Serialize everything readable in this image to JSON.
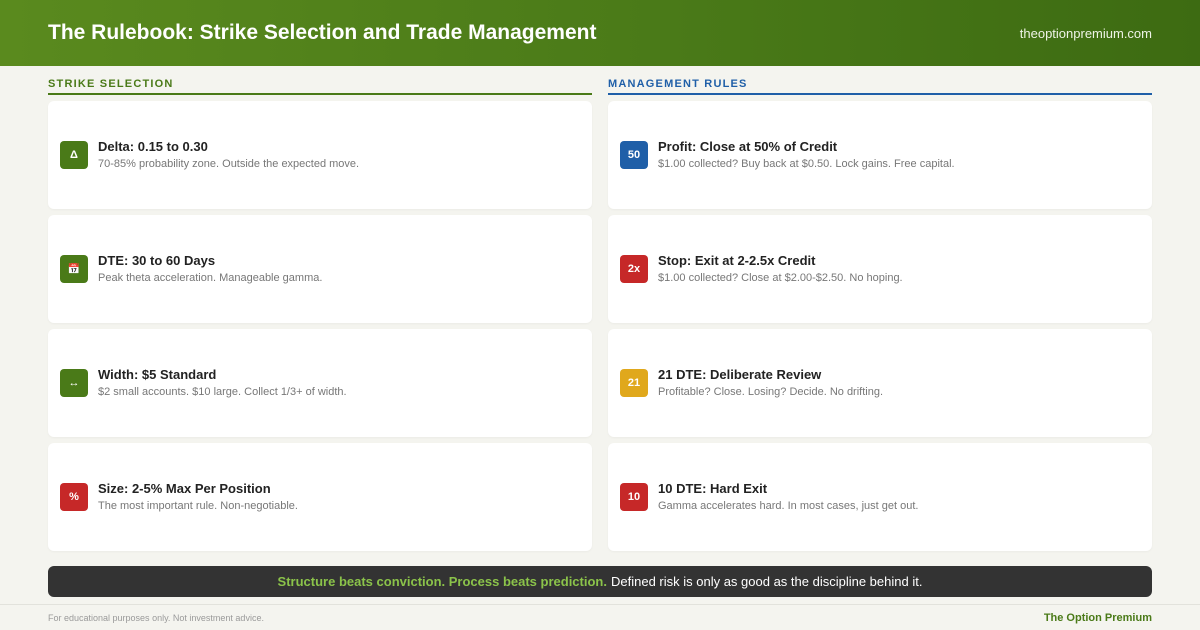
{
  "header": {
    "title": "The Rulebook: Strike Selection and Trade Management",
    "site": "theoptionpremium.com"
  },
  "strike_selection": {
    "heading": "STRIKE SELECTION",
    "cards": [
      {
        "badge": "Δ",
        "badge_icon": "delta-icon",
        "badge_color": "#4a7a18",
        "title": "Delta: 0.15 to 0.30",
        "desc": "70-85% probability zone. Outside the expected move."
      },
      {
        "badge": "📅",
        "badge_icon": "calendar-icon",
        "badge_color": "#4a7a18",
        "title": "DTE: 30 to 60 Days",
        "desc": "Peak theta acceleration. Manageable gamma."
      },
      {
        "badge": "↔",
        "badge_icon": "width-arrows-icon",
        "badge_color": "#4a7a18",
        "title": "Width: $5 Standard",
        "desc": "$2 small accounts. $10 large. Collect 1/3+ of width."
      },
      {
        "badge": "%",
        "badge_icon": "percent-icon",
        "badge_color": "#c62828",
        "title": "Size: 2-5% Max Per Position",
        "desc": "The most important rule. Non-negotiable."
      }
    ]
  },
  "management_rules": {
    "heading": "MANAGEMENT RULES",
    "cards": [
      {
        "badge": "50",
        "badge_icon": "profit-target-icon",
        "badge_color": "#1f5fa8",
        "title": "Profit: Close at 50% of Credit",
        "desc": "$1.00 collected? Buy back at $0.50. Lock gains. Free capital."
      },
      {
        "badge": "2x",
        "badge_icon": "stop-loss-icon",
        "badge_color": "#c62828",
        "title": "Stop: Exit at 2-2.5x Credit",
        "desc": "$1.00 collected? Close at $2.00-$2.50. No hoping."
      },
      {
        "badge": "21",
        "badge_icon": "review-day-icon",
        "badge_color": "#e0a81c",
        "title": "21 DTE: Deliberate Review",
        "desc": "Profitable? Close. Losing? Decide. No drifting."
      },
      {
        "badge": "10",
        "badge_icon": "hard-exit-icon",
        "badge_color": "#c62828",
        "title": "10 DTE: Hard Exit",
        "desc": "Gamma accelerates hard. In most cases, just get out."
      }
    ]
  },
  "banner": {
    "accent": "Structure beats conviction. Process beats prediction.",
    "rest": "Defined risk is only as good as the discipline behind it."
  },
  "footer": {
    "disclaimer": "For educational purposes only. Not investment advice.",
    "brand": "The Option Premium"
  }
}
